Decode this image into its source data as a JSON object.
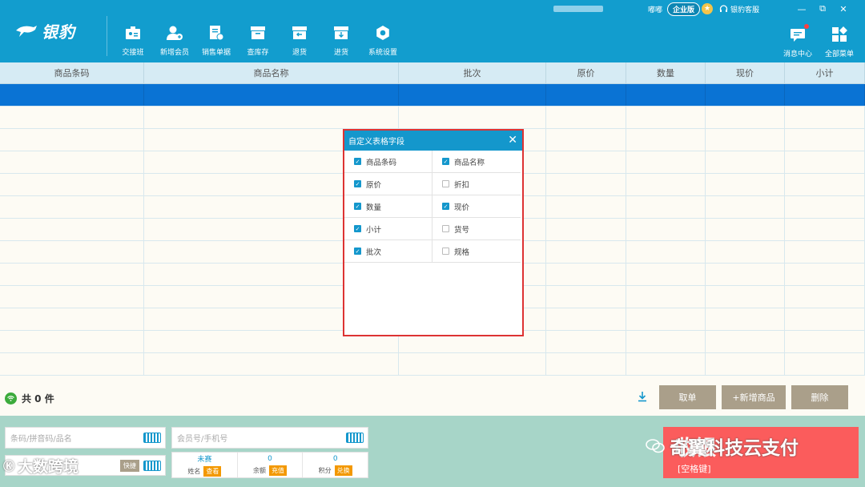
{
  "app": {
    "logo_text": "银豹",
    "user_name": "嘟嘟",
    "edition": "企业版",
    "customer_service": "银豹客服"
  },
  "window_controls": {
    "minimize": "—",
    "restore": "⧉",
    "close": "✕"
  },
  "toolbar": [
    {
      "label": "交接班",
      "icon": "handover-icon"
    },
    {
      "label": "新增会员",
      "icon": "add-member-icon"
    },
    {
      "label": "销售单据",
      "icon": "sales-receipt-icon"
    },
    {
      "label": "查库存",
      "icon": "inventory-icon"
    },
    {
      "label": "退货",
      "icon": "return-icon"
    },
    {
      "label": "进货",
      "icon": "purchase-icon"
    },
    {
      "label": "系统设置",
      "icon": "settings-icon"
    }
  ],
  "right_tools": [
    {
      "label": "消息中心",
      "icon": "message-icon"
    },
    {
      "label": "全部菜单",
      "icon": "all-menu-icon"
    }
  ],
  "table": {
    "columns": [
      "商品条码",
      "商品名称",
      "批次",
      "原价",
      "数量",
      "现价",
      "小计"
    ]
  },
  "dialog": {
    "title": "自定义表格字段",
    "close": "✕",
    "fields": [
      {
        "label": "商品条码",
        "checked": true
      },
      {
        "label": "商品名称",
        "checked": true
      },
      {
        "label": "原价",
        "checked": true
      },
      {
        "label": "折扣",
        "checked": false
      },
      {
        "label": "数量",
        "checked": true
      },
      {
        "label": "现价",
        "checked": true
      },
      {
        "label": "小计",
        "checked": true
      },
      {
        "label": "货号",
        "checked": false
      },
      {
        "label": "批次",
        "checked": true
      },
      {
        "label": "规格",
        "checked": false
      }
    ]
  },
  "status": {
    "total_label": "共 0 件"
  },
  "actions": {
    "cancel": "取单",
    "add_product": "+新增商品",
    "delete": "删除"
  },
  "bottom": {
    "barcode_placeholder": "条码/拼音码/品名",
    "quick_label": "快捷",
    "member_placeholder": "会员号/手机号",
    "member_name": "未赛",
    "member_name_label": "姓名",
    "view_btn": "查看",
    "balance_value": "0",
    "balance_label": "余额",
    "recharge_btn": "充值",
    "points_value": "0",
    "points_label": "积分",
    "redeem_btn": "兑换",
    "checkout_label": "收银",
    "checkout_hint": "[空格键]"
  },
  "watermarks": {
    "left": "大数跨境",
    "right": "奇翼科技云支付"
  },
  "colors": {
    "header": "#129dce",
    "selected_row": "#0a73d4",
    "checkout": "#fb5c5c",
    "bottom_panel": "#a7d5c8"
  }
}
